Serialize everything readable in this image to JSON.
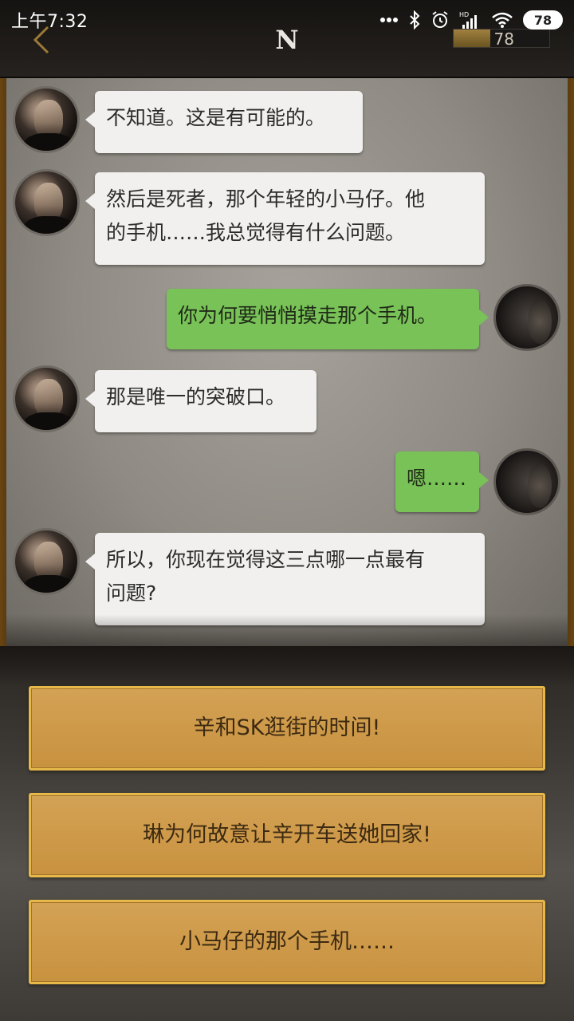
{
  "status_bar": {
    "time": "上午7:32",
    "battery": "78"
  },
  "header": {
    "logo_letter": "N",
    "progress_value": "78",
    "progress_fraction": 0.38
  },
  "messages": [
    {
      "side": "left",
      "text": "不知道。这是有可能的。"
    },
    {
      "side": "left",
      "text_lines": [
        "然后是死者，那个年轻的小马仔。他",
        "的手机……我总觉得有什么问题。"
      ]
    },
    {
      "side": "right",
      "text": "你为何要悄悄摸走那个手机。"
    },
    {
      "side": "left",
      "text": "那是唯一的突破口。"
    },
    {
      "side": "right",
      "text": "嗯……"
    },
    {
      "side": "left",
      "text_lines": [
        "所以，你现在觉得这三点哪一点最有",
        "问题?"
      ]
    }
  ],
  "choices": [
    "辛和SK逛街的时间!",
    "琳为何故意让辛开车送她回家!",
    "小马仔的那个手机……"
  ],
  "colors": {
    "accent_gold": "#c8923f",
    "bubble_green": "#78c258",
    "bubble_white": "#f1f0ee"
  }
}
